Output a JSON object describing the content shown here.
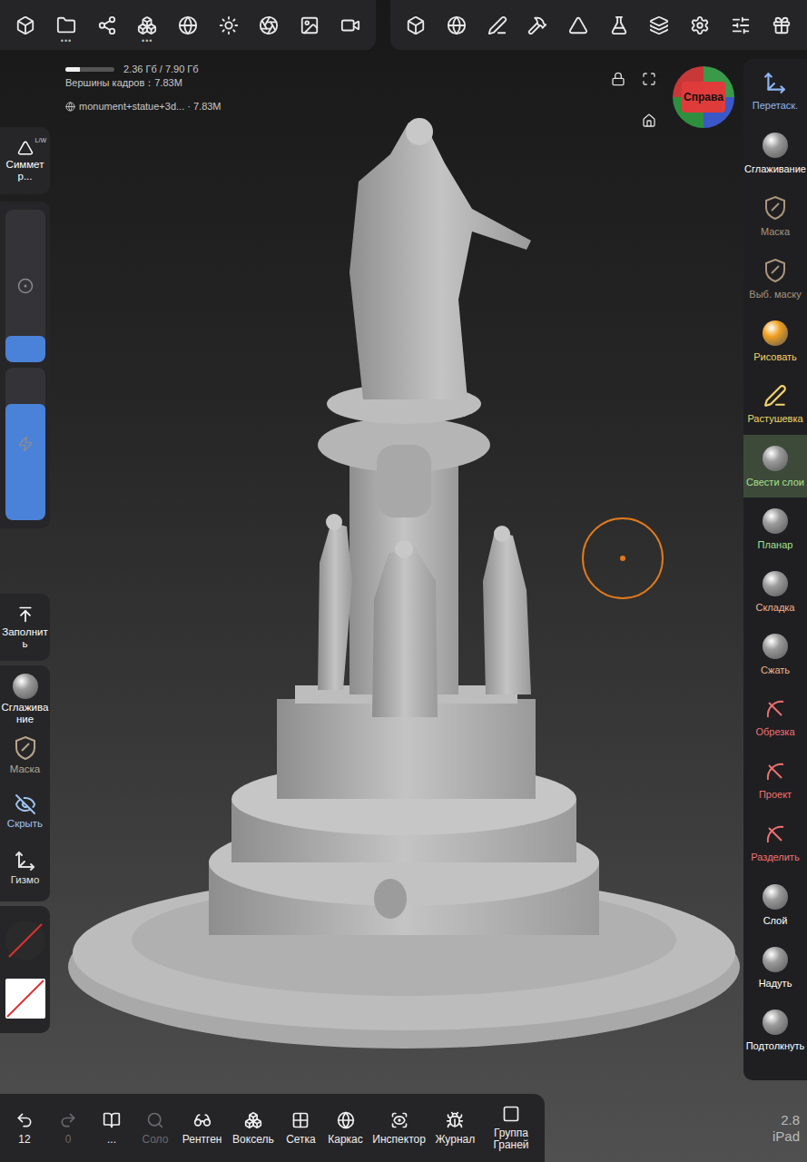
{
  "top_bar": {
    "left_tools": [
      {
        "more": false
      },
      {
        "more": true
      },
      {
        "more": false
      },
      {
        "more": true
      },
      {
        "more": false
      },
      {
        "more": false
      },
      {
        "more": false
      },
      {
        "more": false
      },
      {
        "more": false
      }
    ],
    "right_tools": [
      {
        "more": false
      },
      {
        "more": false
      },
      {
        "more": false
      },
      {
        "more": false
      },
      {
        "more": false
      },
      {
        "more": false
      },
      {
        "more": false
      },
      {
        "more": false
      },
      {
        "more": false
      },
      {
        "more": false
      }
    ]
  },
  "info": {
    "memory": "2.36 Гб / 7.90 Гб",
    "memory_level": 0.3,
    "vertices": "Вершины кадров：7.83M",
    "object": "monument+statue+3d... · 7.83M"
  },
  "view_cube": {
    "label": "Справа"
  },
  "symmetry": {
    "label": "Симметр...",
    "badge": "L/W",
    "on": true
  },
  "sliders": [
    {
      "name": "radius",
      "level": 0.17
    },
    {
      "name": "intensity",
      "level": 0.76
    }
  ],
  "fill_button": {
    "label": "Заполнить"
  },
  "left_tools": [
    {
      "label": "Сглаживание",
      "color": "#ffffff"
    },
    {
      "label": "Маска",
      "color": "#b8a58c"
    },
    {
      "label": "Скрыть",
      "color": "#9fc3f0"
    },
    {
      "label": "Гизмо",
      "color": "#e0e0e0"
    }
  ],
  "right_tools": [
    {
      "label": "Перетаск.",
      "kind": "drag",
      "color": "#8fb5f0",
      "selected": false
    },
    {
      "label": "Сглаживание",
      "kind": "sphere",
      "color": "#ffffff",
      "selected": false
    },
    {
      "label": "Маска",
      "kind": "shield",
      "color": "#a8957c",
      "selected": false
    },
    {
      "label": "Выб. маску",
      "kind": "shield",
      "color": "#a8957c",
      "selected": false
    },
    {
      "label": "Рисовать",
      "kind": "paint",
      "color": "#f2d36b",
      "selected": false
    },
    {
      "label": "Растушевка",
      "kind": "smudge",
      "color": "#f2d36b",
      "selected": false
    },
    {
      "label": "Свести слои",
      "kind": "sphere",
      "color": "#a8e08c",
      "selected": true
    },
    {
      "label": "Планар",
      "kind": "sphere",
      "color": "#a8e08c",
      "selected": false
    },
    {
      "label": "Складка",
      "kind": "sphere",
      "color": "#f0b48a",
      "selected": false
    },
    {
      "label": "Сжать",
      "kind": "sphere",
      "color": "#f0b48a",
      "selected": false
    },
    {
      "label": "Обрезка",
      "kind": "cut",
      "color": "#f07070",
      "selected": false
    },
    {
      "label": "Проект",
      "kind": "cut",
      "color": "#f07070",
      "selected": false
    },
    {
      "label": "Разделить",
      "kind": "cut",
      "color": "#f07070",
      "selected": false
    },
    {
      "label": "Слой",
      "kind": "sphere",
      "color": "#ffffff",
      "selected": false
    },
    {
      "label": "Надуть",
      "kind": "sphere",
      "color": "#ffffff",
      "selected": false
    },
    {
      "label": "Подтолкнуть",
      "kind": "sphere",
      "color": "#ffffff",
      "selected": false
    }
  ],
  "bottom_bar": [
    {
      "label": "12",
      "disabled": false
    },
    {
      "label": "0",
      "disabled": true
    },
    {
      "label": "...",
      "disabled": false
    },
    {
      "label": "Соло",
      "disabled": true
    },
    {
      "label": "Рентген",
      "disabled": false
    },
    {
      "label": "Воксель",
      "disabled": false
    },
    {
      "label": "Сетка",
      "disabled": false
    },
    {
      "label": "Каркас",
      "disabled": false
    },
    {
      "label": "Инспектор",
      "disabled": false
    },
    {
      "label": "Журнал",
      "disabled": false
    },
    {
      "label": "Группа Граней",
      "disabled": false
    }
  ],
  "version": {
    "number": "2.8",
    "device": "iPad"
  }
}
